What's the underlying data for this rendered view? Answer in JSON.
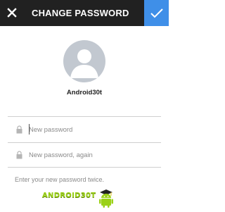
{
  "topbar": {
    "title": "CHANGE PASSWORD",
    "close_icon": "close-icon",
    "confirm_icon": "checkmark-icon",
    "background": "#212121",
    "accent": "#3f8fe8"
  },
  "profile": {
    "username": "Android30t",
    "avatar_icon": "avatar-placeholder-icon"
  },
  "form": {
    "new_password": {
      "placeholder": "New password",
      "value": "",
      "icon": "lock-icon"
    },
    "confirm_password": {
      "placeholder": "New password, again",
      "value": "",
      "icon": "lock-icon"
    },
    "hint": "Enter your new password twice."
  },
  "watermark": {
    "text": "ANDROID30T",
    "mascot_icon": "android-mascot-graduate-icon",
    "color": "#9bd118"
  }
}
